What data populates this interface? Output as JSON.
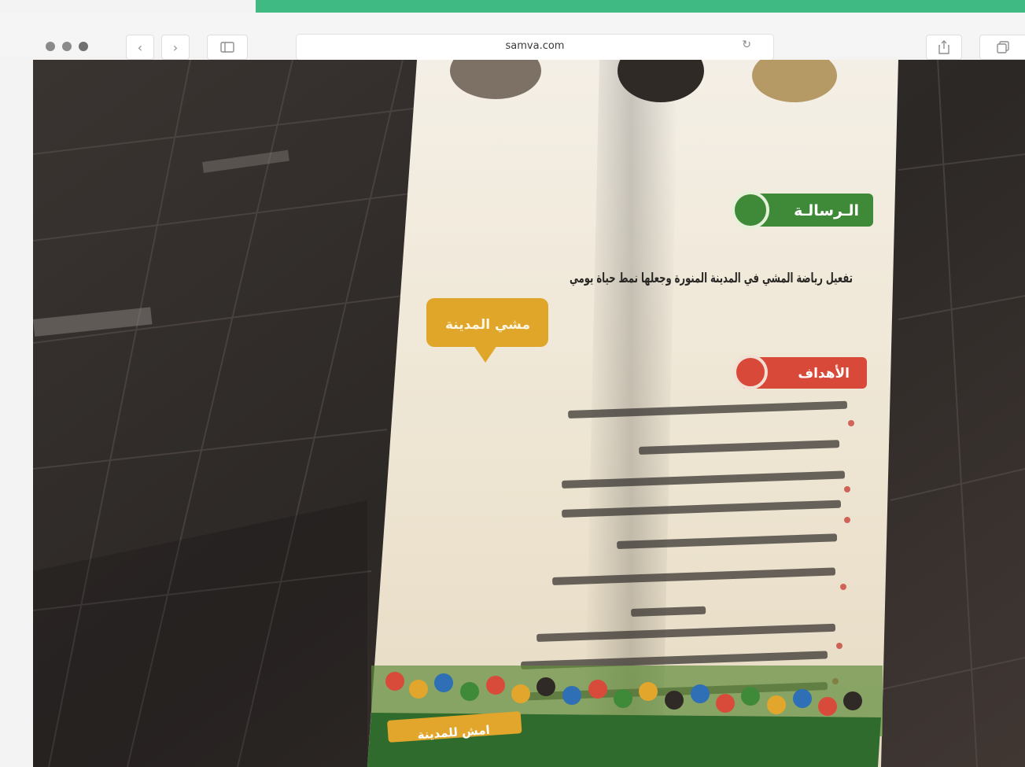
{
  "browser": {
    "url": "samva.com",
    "accent_color": "#3fba82",
    "icons": [
      "close-dot",
      "minimize-dot",
      "zoom-dot",
      "back-icon",
      "forward-icon",
      "sidebar-icon",
      "reload-icon",
      "share-icon",
      "tabs-icon"
    ]
  },
  "flyer": {
    "section1_heading": "الـرسالـة",
    "section1_text": "تفعيل رياضة المشي في المدينة المنورة وجعلها نمط حياة يومي",
    "section2_heading": "الأهداف",
    "speech_bubble": "مشي المدينة",
    "footer_banner": "امش للمدينة"
  }
}
